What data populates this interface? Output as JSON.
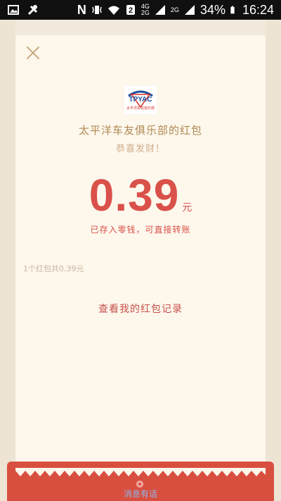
{
  "statusbar": {
    "battery_percent": "34%",
    "time": "16:24",
    "network_top": "4G",
    "network_bottom": "2G",
    "network_label": "2G"
  },
  "close_icon": "close-icon",
  "sender_line": "太平洋车友俱乐部的红包",
  "greeting": "恭喜发财！",
  "amount": "0.39",
  "amount_unit": "元",
  "saved_note": "已存入零钱，可直接转账",
  "summary": "1个红包共0.39元",
  "record_link": "查看我的红包记录",
  "bottom_text": "消息有话",
  "logo": {
    "brand": "TPYAC",
    "subtitle": "太平洋车友俱乐部"
  },
  "colors": {
    "accent_red": "#d9514a",
    "card_bg": "#fdf7ec",
    "band_red": "#d84f40"
  }
}
